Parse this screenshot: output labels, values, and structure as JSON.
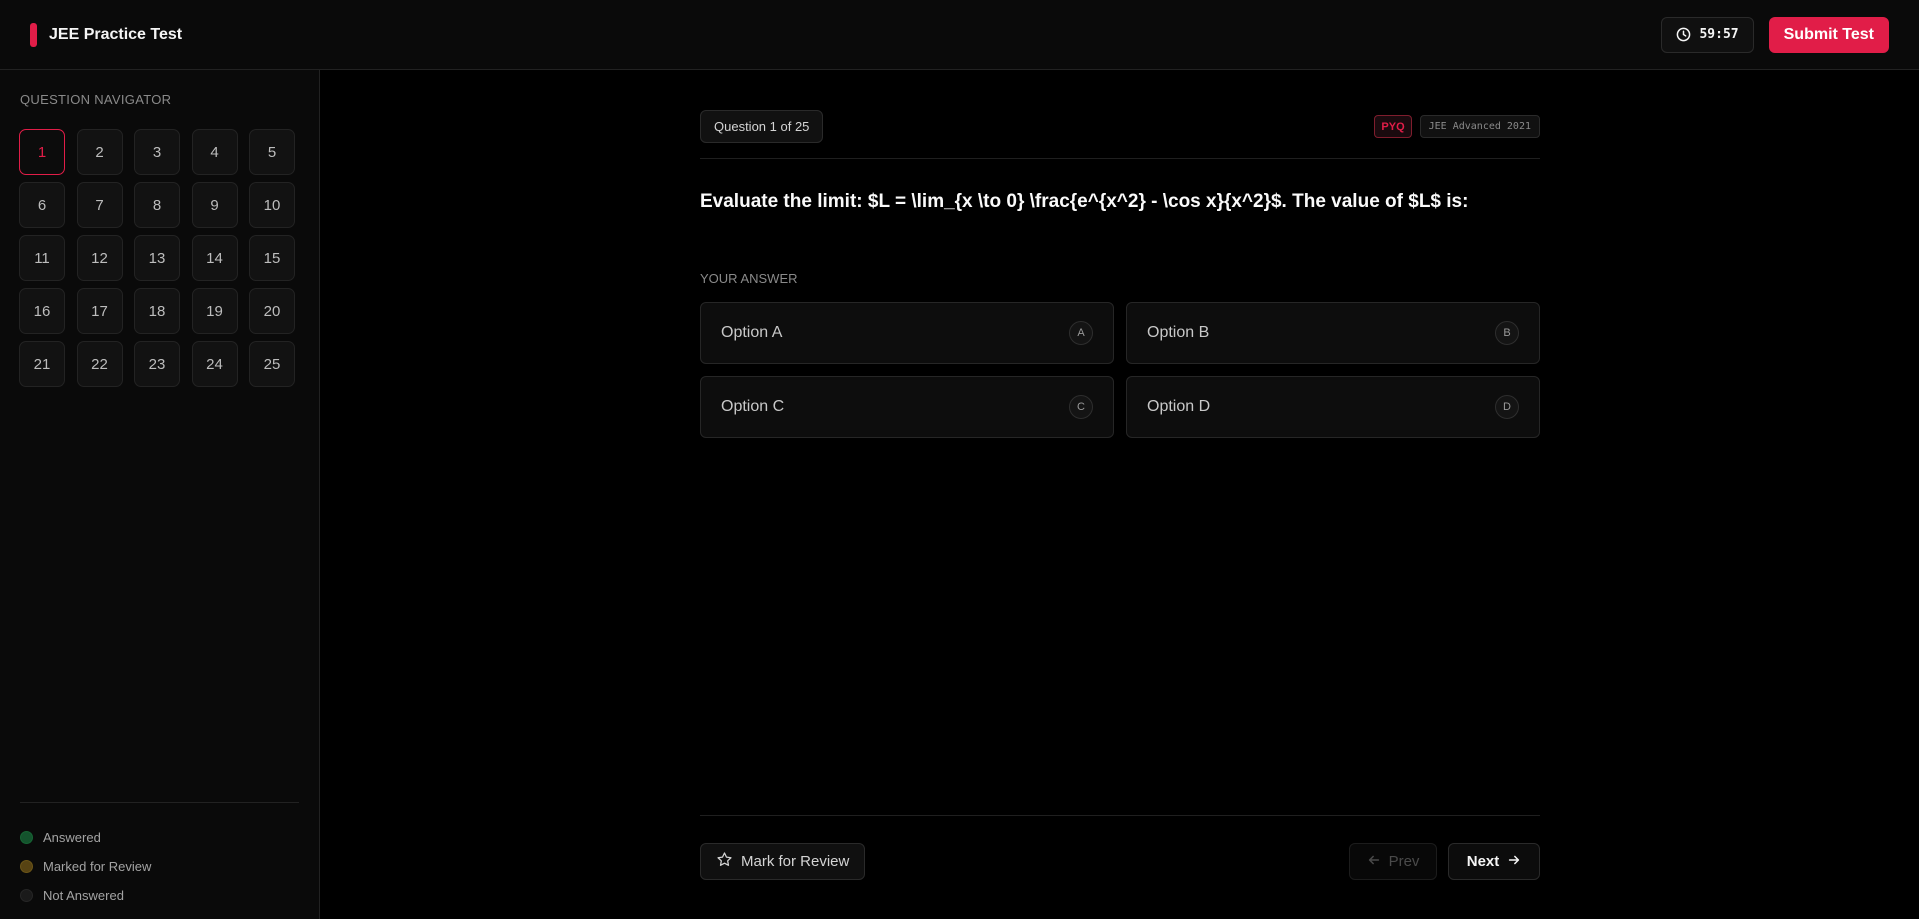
{
  "header": {
    "title": "JEE Practice Test",
    "timer": "59:57",
    "submit_label": "Submit Test"
  },
  "sidebar": {
    "title": "QUESTION NAVIGATOR",
    "questions": [
      "1",
      "2",
      "3",
      "4",
      "5",
      "6",
      "7",
      "8",
      "9",
      "10",
      "11",
      "12",
      "13",
      "14",
      "15",
      "16",
      "17",
      "18",
      "19",
      "20",
      "21",
      "22",
      "23",
      "24",
      "25"
    ],
    "current": "1",
    "legend": {
      "answered": "Answered",
      "review": "Marked for Review",
      "not_answered": "Not Answered"
    }
  },
  "question": {
    "counter": "Question 1 of 25",
    "tag": "PYQ",
    "exam": "JEE Advanced 2021",
    "text": "Evaluate the limit: $L = \\lim_{x \\to 0} \\frac{e^{x^2} - \\cos x}{x^2}$. The value of $L$ is:",
    "answer_label": "YOUR ANSWER",
    "options": [
      {
        "label": "Option A",
        "key": "A"
      },
      {
        "label": "Option B",
        "key": "B"
      },
      {
        "label": "Option C",
        "key": "C"
      },
      {
        "label": "Option D",
        "key": "D"
      }
    ]
  },
  "footer": {
    "mark_label": "Mark for Review",
    "prev_label": "Prev",
    "next_label": "Next"
  },
  "colors": {
    "accent": "#e11d48",
    "background": "#000000",
    "panel": "#0a0a0a"
  }
}
